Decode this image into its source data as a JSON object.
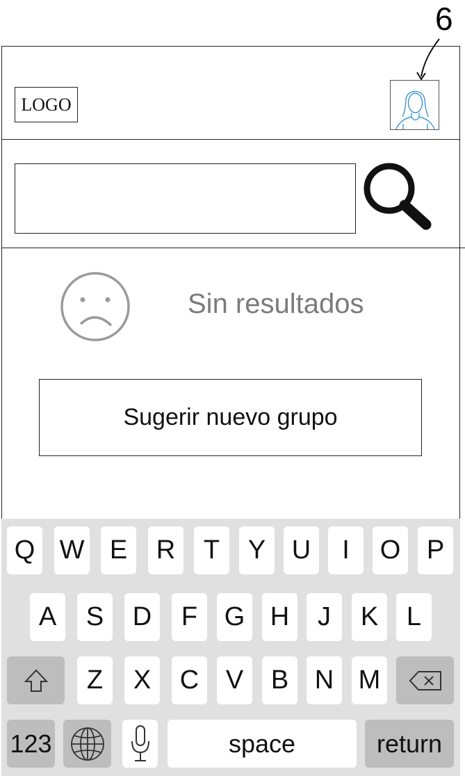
{
  "annotation": {
    "label": "6"
  },
  "header": {
    "logo_text": "LOGO",
    "avatar_icon": "user-avatar-icon"
  },
  "search": {
    "value": "",
    "placeholder": "",
    "icon": "magnifier-icon"
  },
  "results": {
    "empty_icon": "sad-face-icon",
    "empty_text": "Sin resultados"
  },
  "suggest_button": {
    "label": "Sugerir nuevo grupo"
  },
  "keyboard": {
    "rows": [
      [
        "Q",
        "W",
        "E",
        "R",
        "T",
        "Y",
        "U",
        "I",
        "O",
        "P"
      ],
      [
        "A",
        "S",
        "D",
        "F",
        "G",
        "H",
        "J",
        "K",
        "L"
      ],
      [
        "Z",
        "X",
        "C",
        "V",
        "B",
        "N",
        "M"
      ]
    ],
    "shift_icon": "shift-arrow-icon",
    "backspace_icon": "backspace-icon",
    "numbers_label": "123",
    "globe_icon": "globe-icon",
    "mic_icon": "microphone-icon",
    "space_label": "space",
    "return_label": "return"
  },
  "colors": {
    "frame": "#222222",
    "muted_text": "#7b7b7b",
    "sad_face": "#9a9a9a",
    "avatar_line": "#1e88c8",
    "keyboard_bg": "#e0e0e0",
    "key_light": "#ffffff",
    "key_dark": "#bdbdbd"
  }
}
